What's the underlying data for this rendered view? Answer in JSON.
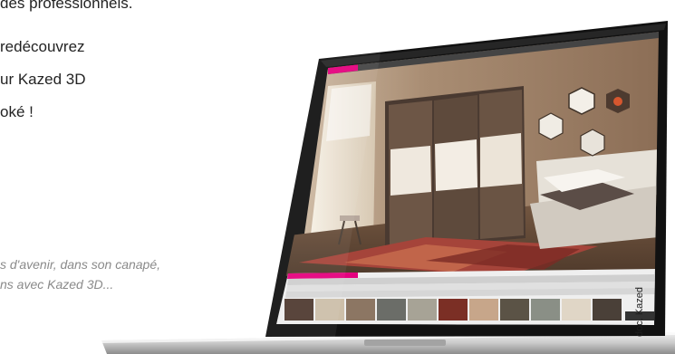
{
  "article": {
    "lines": [
      "des professionnels.",
      "redécouvrez",
      "ur Kazed 3D",
      "oké !"
    ],
    "caption": [
      "s d'avenir, dans son canapé,",
      "ns avec Kazed 3D..."
    ]
  },
  "photo_credit": "doc. Kazed",
  "app": {
    "name": "Kazed 3D",
    "accent_color": "#e5007e",
    "swatch_colors": [
      "#4f3a30",
      "#cdbfa9",
      "#8c7663",
      "#6b6d68",
      "#a7a396",
      "#7b2f25",
      "#c7a68a",
      "#5b5346",
      "#8a8f86",
      "#e0d6c6",
      "#4a4038"
    ]
  }
}
